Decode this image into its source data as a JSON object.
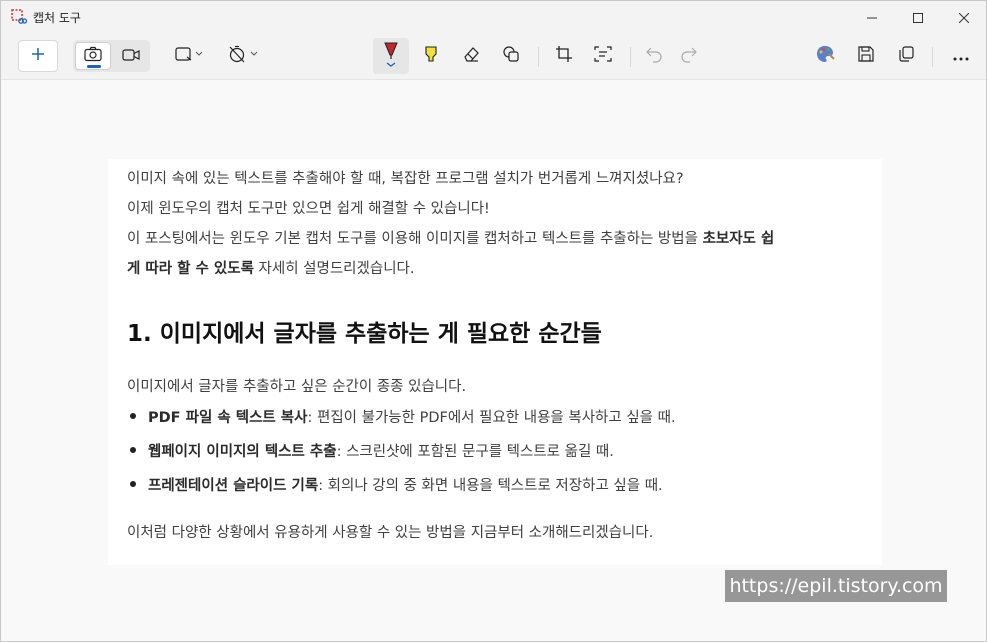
{
  "window": {
    "title": "캡처 도구"
  },
  "toolbar": {
    "new_icon": "plus-icon",
    "modes": [
      "camera-icon",
      "video-icon"
    ],
    "tools": [
      "rectangle-snip-icon",
      "timer-off-icon",
      "ballpoint-pen-icon",
      "highlighter-icon",
      "eraser-icon",
      "shapes-icon",
      "crop-icon",
      "text-actions-icon",
      "undo-icon",
      "redo-icon",
      "paint-icon",
      "save-icon",
      "copy-icon",
      "more-icon"
    ],
    "accent": "#1a66b8",
    "pen_color": "#c0282d",
    "highlighter_color": "#f3e03b"
  },
  "content": {
    "para1": "이미지 속에 있는 텍스트를 추출해야 할 때, 복잡한 프로그램 설치가 번거롭게 느껴지셨나요?",
    "para2": "이제 윈도우의 캡처 도구만 있으면 쉽게 해결할 수 있습니다!",
    "para3_a": "이 포스팅에서는 윈도우 기본 캡처 도구를 이용해 이미지를 캡처하고 텍스트를 추출하는 방법을 ",
    "para3_bold1": "초보자도 쉽",
    "para3_bold2": "게 따라 할 수 있도록",
    "para3_b": " 자세히 설명드리겠습니다.",
    "heading": "1. 이미지에서 글자를 추출하는 게 필요한 순간들",
    "intro": "이미지에서 글자를 추출하고 싶은 순간이 종종 있습니다.",
    "bullets": [
      {
        "bold": "PDF 파일 속 텍스트 복사",
        "text": ": 편집이 불가능한 PDF에서 필요한 내용을 복사하고 싶을 때."
      },
      {
        "bold": "웹페이지 이미지의 텍스트 추출",
        "text": ": 스크린샷에 포함된 문구를 텍스트로 옮길 때."
      },
      {
        "bold": "프레젠테이션 슬라이드 기록",
        "text": ": 회의나 강의 중 화면 내용을 텍스트로 저장하고 싶을 때."
      }
    ],
    "closing": "이처럼 다양한 상황에서 유용하게 사용할 수 있는 방법을 지금부터 소개해드리겠습니다."
  },
  "watermark": "https://epil.tistory.com"
}
